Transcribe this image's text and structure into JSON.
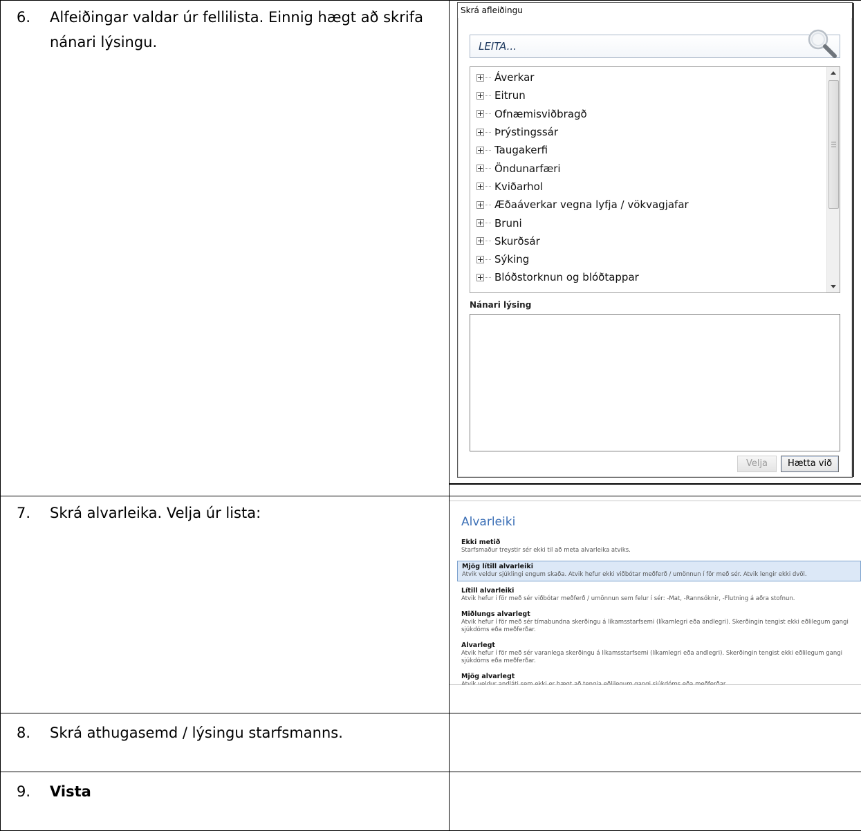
{
  "steps": [
    {
      "num": "6.",
      "text": "Alfeiðingar valdar úr fellilista. Einnig hægt að skrifa nánari lýsingu."
    },
    {
      "num": "7.",
      "text": "Skrá alvarleika. Velja úr lista:"
    },
    {
      "num": "8.",
      "text": "Skrá athugasemd / lýsingu starfsmanns."
    },
    {
      "num": "9.",
      "text": "Vista"
    }
  ],
  "dialog": {
    "title": "Skrá afleiðingu",
    "search_placeholder": "LEITA...",
    "tree_items": [
      "Áverkar",
      "Eitrun",
      "Ofnæmisviðbragð",
      "Þrýstingssár",
      "Taugakerfi",
      "Öndunarfæri",
      "Kviðarhol",
      "Æðaáverkar vegna lyfja / vökvagjafar",
      "Bruni",
      "Skurðsár",
      "Sýking",
      "Blóðstorknun og blóðtappar"
    ],
    "description_label": "Nánari lýsing",
    "buttons": {
      "select": "Velja",
      "cancel": "Hætta við"
    }
  },
  "severity": {
    "title": "Alvarleiki",
    "selected_index": 1,
    "options": [
      {
        "name": "Ekki metið",
        "desc": "Starfsmaður treystir sér ekki til að meta alvarleika atviks."
      },
      {
        "name": "Mjög lítill alvarleiki",
        "desc": "Atvik veldur sjúklingi engum skaða. Atvik hefur ekki viðbótar meðferð / umönnun í för með sér. Atvik lengir ekki dvöl."
      },
      {
        "name": "Lítill alvarleiki",
        "desc": "Atvik hefur í för með sér viðbótar meðferð / umönnun sem felur í sér: -Mat, -Rannsóknir, -Flutning á aðra stofnun."
      },
      {
        "name": "Miðlungs alvarlegt",
        "desc": "Atvik hefur í för með sér tímabundna skerðingu á líkamsstarfsemi (líkamlegri eða andlegri). Skerðingin tengist ekki eðlilegum gangi sjúkdóms eða meðferðar."
      },
      {
        "name": "Alvarlegt",
        "desc": "Atvik hefur í för með sér varanlega skerðingu á líkamsstarfsemi (líkamlegri eða andlegri). Skerðingin tengist ekki eðlilegum gangi sjúkdóms eða meðferðar."
      },
      {
        "name": "Mjög alvarlegt",
        "desc": "Atvik veldur andláti sem ekki er hægt að tengja eðlilegum gangi sjúkdóms eða meðferðar."
      }
    ]
  },
  "colors": {
    "accent": "#3b6fb6",
    "selected_bg": "#dce8f7"
  }
}
